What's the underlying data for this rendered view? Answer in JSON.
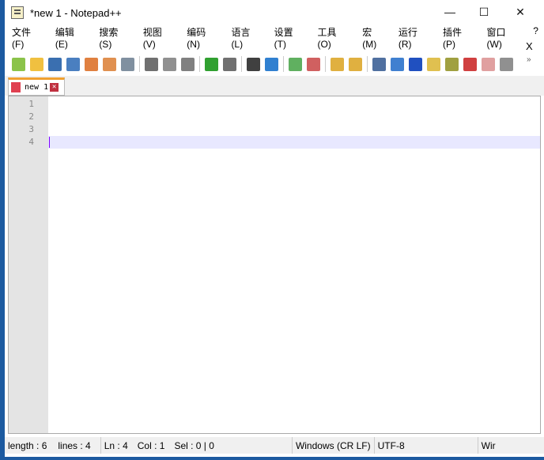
{
  "window": {
    "title": "*new 1 - Notepad++",
    "minimize": "—",
    "maximize": "☐",
    "close": "✕"
  },
  "menu": [
    "文件(F)",
    "编辑(E)",
    "搜索(S)",
    "视图(V)",
    "编码(N)",
    "语言(L)",
    "设置(T)",
    "工具(O)",
    "宏(M)",
    "运行(R)",
    "插件(P)",
    "窗口(W)",
    "?"
  ],
  "menu_close": "X",
  "toolbar": {
    "groups": [
      [
        {
          "name": "new-file-icon",
          "color": "#8bc34a"
        },
        {
          "name": "open-file-icon",
          "color": "#f0c040"
        },
        {
          "name": "save-icon",
          "color": "#3a6fb0"
        },
        {
          "name": "save-all-icon",
          "color": "#4a7fc0"
        },
        {
          "name": "close-icon",
          "color": "#e08040"
        },
        {
          "name": "close-all-icon",
          "color": "#e09050"
        },
        {
          "name": "print-icon",
          "color": "#8090a0"
        }
      ],
      [
        {
          "name": "cut-icon",
          "color": "#707070"
        },
        {
          "name": "copy-icon",
          "color": "#909090"
        },
        {
          "name": "paste-icon",
          "color": "#808080"
        }
      ],
      [
        {
          "name": "undo-icon",
          "color": "#30a030"
        },
        {
          "name": "redo-icon",
          "color": "#707070"
        }
      ],
      [
        {
          "name": "find-icon",
          "color": "#404040"
        },
        {
          "name": "replace-icon",
          "color": "#3080d0"
        }
      ],
      [
        {
          "name": "zoom-in-icon",
          "color": "#60b060"
        },
        {
          "name": "zoom-out-icon",
          "color": "#d06060"
        }
      ],
      [
        {
          "name": "sync-vertical-icon",
          "color": "#e0b040"
        },
        {
          "name": "sync-horizontal-icon",
          "color": "#e0b040"
        }
      ],
      [
        {
          "name": "word-wrap-icon",
          "color": "#5070a0"
        },
        {
          "name": "show-all-chars-icon",
          "color": "#4080d0"
        },
        {
          "name": "indent-guide-icon",
          "color": "#2050c0"
        },
        {
          "name": "doc-map-icon",
          "color": "#e0c050"
        },
        {
          "name": "function-list-icon",
          "color": "#a0a040"
        },
        {
          "name": "folder-workspace-icon",
          "color": "#d04040"
        },
        {
          "name": "record-macro-icon",
          "color": "#e0a0a0"
        },
        {
          "name": "stop-record-icon",
          "color": "#909090"
        }
      ]
    ],
    "more": "»"
  },
  "tab": {
    "label": "new 1",
    "close": "✕"
  },
  "editor": {
    "line_numbers": [
      "1",
      "2",
      "3",
      "4"
    ],
    "current_line": 4
  },
  "status": {
    "length": "length : 6",
    "lines": "lines : 4",
    "ln": "Ln : 4",
    "col": "Col : 1",
    "sel": "Sel : 0 | 0",
    "eol": "Windows (CR LF)",
    "encoding": "UTF-8",
    "mode": "Wir"
  }
}
